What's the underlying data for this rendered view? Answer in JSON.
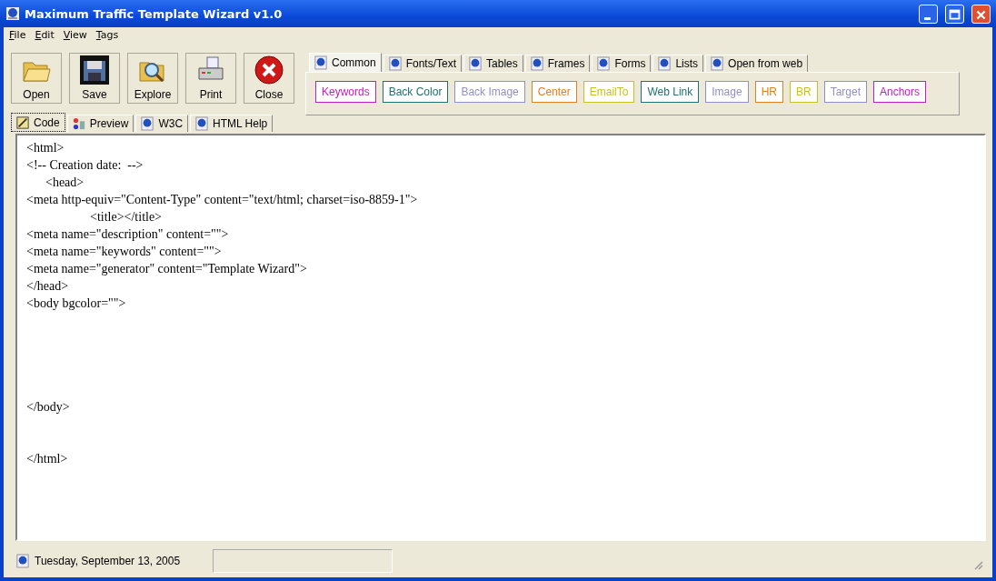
{
  "window": {
    "title": "Maximum Traffic Template Wizard v1.0"
  },
  "menu": [
    "File",
    "Edit",
    "View",
    "Tags"
  ],
  "toolbar": [
    {
      "label": "Open",
      "kind": "open"
    },
    {
      "label": "Save",
      "kind": "save"
    },
    {
      "label": "Explore",
      "kind": "explore"
    },
    {
      "label": "Print",
      "kind": "print"
    },
    {
      "label": "Close",
      "kind": "close"
    }
  ],
  "editor_tabs": [
    {
      "label": "Code",
      "selected": true,
      "kind": "code"
    },
    {
      "label": "Preview",
      "selected": false,
      "kind": "preview"
    },
    {
      "label": "W3C",
      "selected": false,
      "kind": "globe"
    },
    {
      "label": "HTML Help",
      "selected": false,
      "kind": "globe"
    }
  ],
  "tag_tabs": [
    {
      "label": "Common",
      "selected": true
    },
    {
      "label": "Fonts/Text",
      "selected": false
    },
    {
      "label": "Tables",
      "selected": false
    },
    {
      "label": "Frames",
      "selected": false
    },
    {
      "label": "Forms",
      "selected": false
    },
    {
      "label": "Lists",
      "selected": false
    },
    {
      "label": "Open from web",
      "selected": false
    }
  ],
  "tag_buttons": [
    {
      "label": "Keywords",
      "color": "#c020c0"
    },
    {
      "label": "Back Color",
      "color": "#207070"
    },
    {
      "label": "Back Image",
      "color": "#9090c8"
    },
    {
      "label": "Center",
      "color": "#e08020"
    },
    {
      "label": "EmailTo",
      "color": "#c8c020"
    },
    {
      "label": "Web Link",
      "color": "#207070"
    },
    {
      "label": "Image",
      "color": "#9090c8"
    },
    {
      "label": "HR",
      "color": "#e08020"
    },
    {
      "label": "BR",
      "color": "#c8c020"
    },
    {
      "label": "Target",
      "color": "#9090c8"
    },
    {
      "label": "Anchors",
      "color": "#c020c0"
    }
  ],
  "code": "<html>\n<!-- Creation date:  -->\n      <head>\n<meta http-equiv=\"Content-Type\" content=\"text/html; charset=iso-8859-1\">\n                    <title></title>\n<meta name=\"description\" content=\"\">\n<meta name=\"keywords\" content=\"\">\n<meta name=\"generator\" content=\"Template Wizard\">\n</head>\n<body bgcolor=\"\">\n\n\n\n\n\n</body>\n\n\n</html>",
  "status_bar": {
    "date": "Tuesday, September 13, 2005"
  }
}
